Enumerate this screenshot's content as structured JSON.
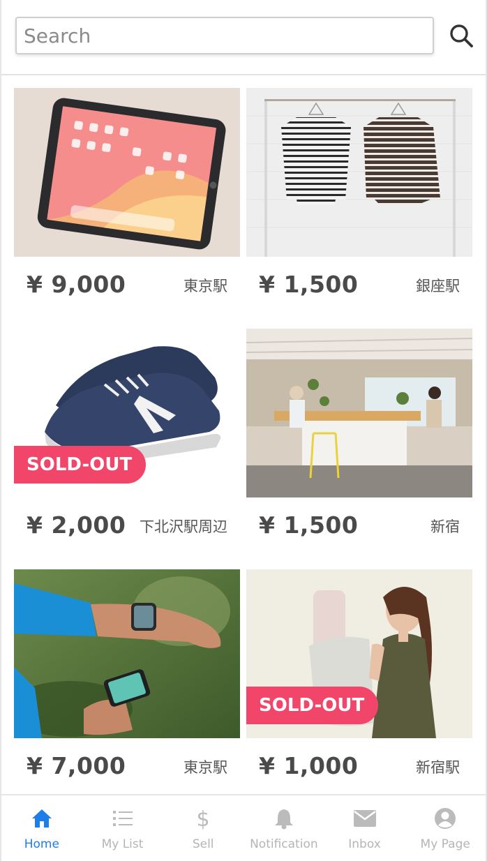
{
  "search": {
    "placeholder": "Search"
  },
  "listings": [
    {
      "price": "¥ 9,000",
      "location": "東京駅",
      "image": "tablet-photo",
      "sold_out": false
    },
    {
      "price": "¥ 1,500",
      "location": "銀座駅",
      "image": "striped-shirts-photo",
      "sold_out": false
    },
    {
      "price": "¥ 2,000",
      "location": "下北沢駅周辺",
      "image": "sneakers-photo",
      "sold_out": true
    },
    {
      "price": "¥ 1,500",
      "location": "新宿",
      "image": "office-space-photo",
      "sold_out": false
    },
    {
      "price": "¥ 7,000",
      "location": "東京駅",
      "image": "smartwatch-photo",
      "sold_out": false
    },
    {
      "price": "¥ 1,000",
      "location": "新宿駅",
      "image": "backpack-model-photo",
      "sold_out": true
    }
  ],
  "badges": {
    "sold_out": "SOLD-OUT"
  },
  "tabbar": {
    "tabs": [
      {
        "label": "Home",
        "icon": "home-icon",
        "active": true
      },
      {
        "label": "My List",
        "icon": "list-icon",
        "active": false
      },
      {
        "label": "Sell",
        "icon": "dollar-icon",
        "active": false
      },
      {
        "label": "Notification",
        "icon": "bell-icon",
        "active": false
      },
      {
        "label": "Inbox",
        "icon": "mail-icon",
        "active": false
      },
      {
        "label": "My Page",
        "icon": "user-icon",
        "active": false
      }
    ]
  },
  "colors": {
    "accent": "#1e7ee8",
    "sold_out": "#f2456a",
    "inactive": "#b5b5b5"
  }
}
